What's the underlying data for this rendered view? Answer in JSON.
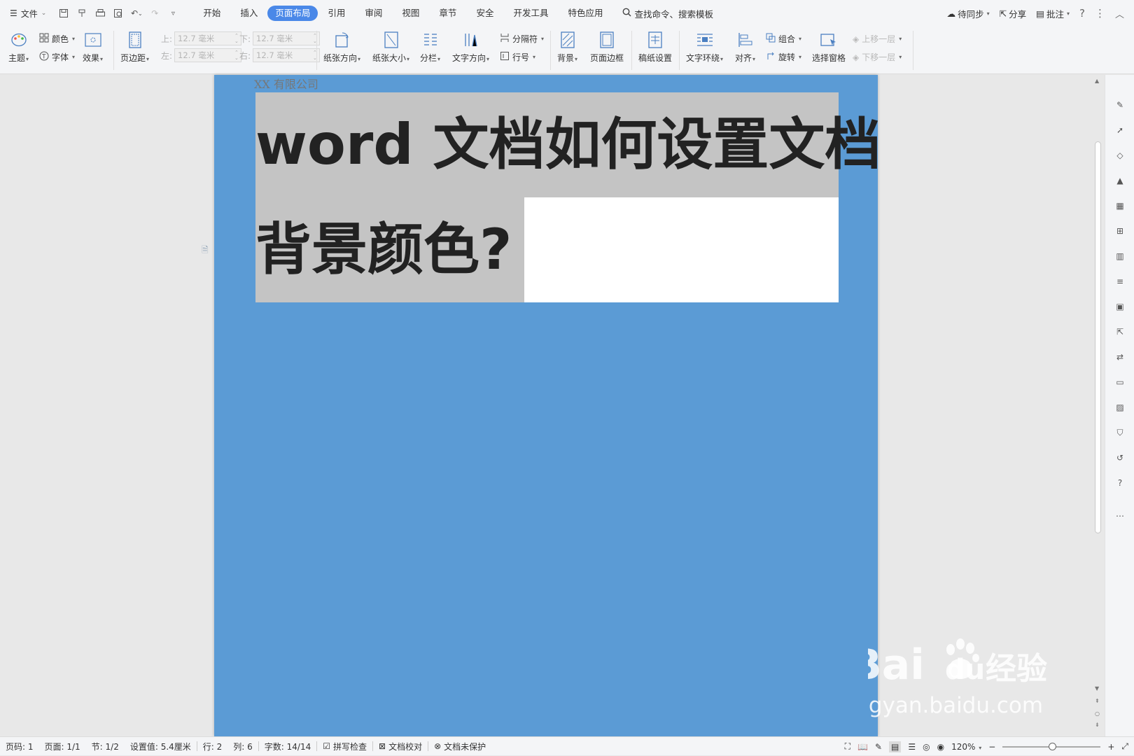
{
  "menu": {
    "file": "文件",
    "tabs": [
      "开始",
      "插入",
      "页面布局",
      "引用",
      "审阅",
      "视图",
      "章节",
      "安全",
      "开发工具",
      "特色应用"
    ],
    "active_tab": "页面布局",
    "search": "查找命令、搜索模板",
    "sync": "待同步",
    "share": "分享",
    "comment": "批注",
    "help": "?"
  },
  "ribbon": {
    "theme": "主题",
    "color": "颜色",
    "font": "字体",
    "effect": "效果",
    "margins": "页边距",
    "margin_top_label": "上:",
    "margin_bottom_label": "下:",
    "margin_left_label": "左:",
    "margin_right_label": "右:",
    "margin_top_value": "12.7 毫米",
    "margin_bottom_value": "12.7 毫米",
    "margin_left_value": "12.7 毫米",
    "margin_right_value": "12.7 毫米",
    "orientation": "纸张方向",
    "size": "纸张大小",
    "columns": "分栏",
    "text_direction": "文字方向",
    "breaks": "分隔符",
    "line_numbers": "行号",
    "background": "背景",
    "page_border": "页面边框",
    "manuscript": "稿纸设置",
    "text_wrap": "文字环绕",
    "align": "对齐",
    "group": "组合",
    "rotate": "旋转",
    "selection_pane": "选择窗格",
    "bring_forward": "上移一层",
    "send_backward": "下移一层"
  },
  "document": {
    "header_text": "XX 有限公司",
    "title_line1": "word 文档如何设置文档",
    "title_line2": "背景颜色?",
    "page_color": "#5b9bd5"
  },
  "status": {
    "page_num": "页码: 1",
    "pages": "页面: 1/1",
    "section": "节: 1/2",
    "setting": "设置值: 5.4厘米",
    "row": "行: 2",
    "col": "列: 6",
    "words": "字数: 14/14",
    "spell": "拼写检查",
    "proof": "文档校对",
    "protect": "文档未保护",
    "zoom": "120%"
  },
  "watermark": {
    "brand": "Bai",
    "brand2": "du",
    "cn": "经验",
    "url": "jingyan.baidu.com"
  }
}
